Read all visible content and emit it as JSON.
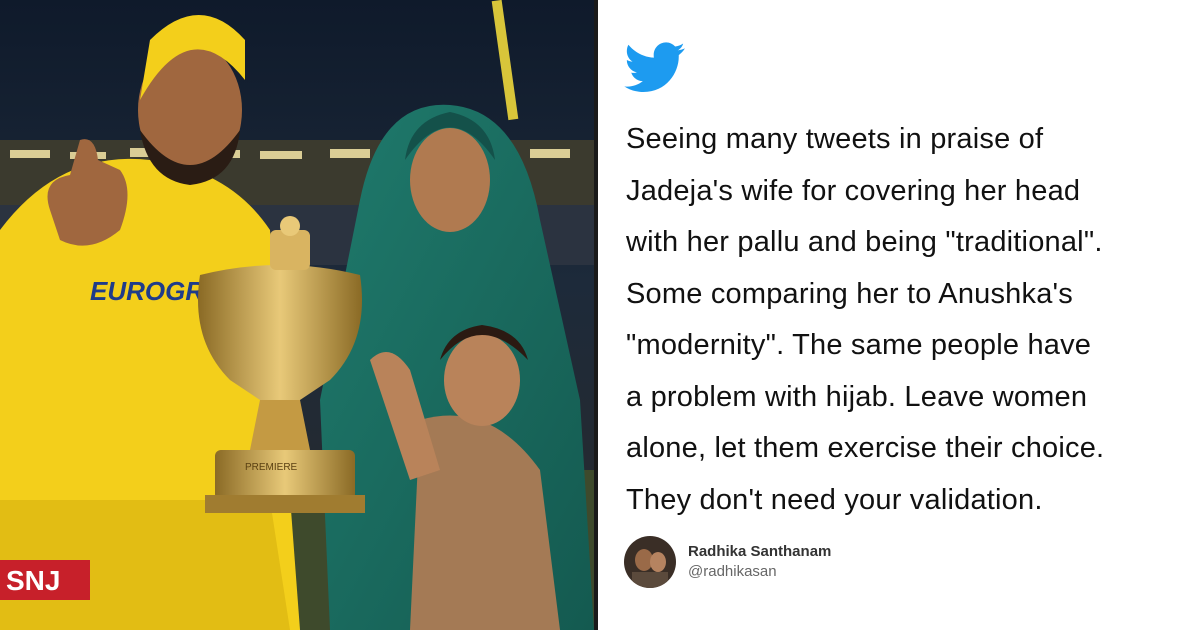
{
  "tweet": {
    "lines": [
      "Seeing many tweets in praise of",
      "Jadeja's wife for covering her head",
      "with her pallu and being \"traditional\".",
      "Some comparing her to Anushka's",
      "\"modernity\". The same people have",
      "a problem with hijab. Leave women",
      "alone, let them exercise their choice.",
      "They don't need your validation."
    ],
    "icon": "twitter-bird-icon"
  },
  "author": {
    "name": "Radhika Santhanam",
    "handle": "@radhikasan"
  },
  "photo": {
    "jersey_text": "TVS EUROGRIP",
    "sponsor_text": "SNJ",
    "trophy_text": "PREMIERE"
  },
  "colors": {
    "twitter_blue": "#1D9BF0",
    "jersey_yellow": "#F5D31B",
    "dupatta_teal": "#1F7A6C",
    "trophy_gold": "#C9A24A"
  }
}
